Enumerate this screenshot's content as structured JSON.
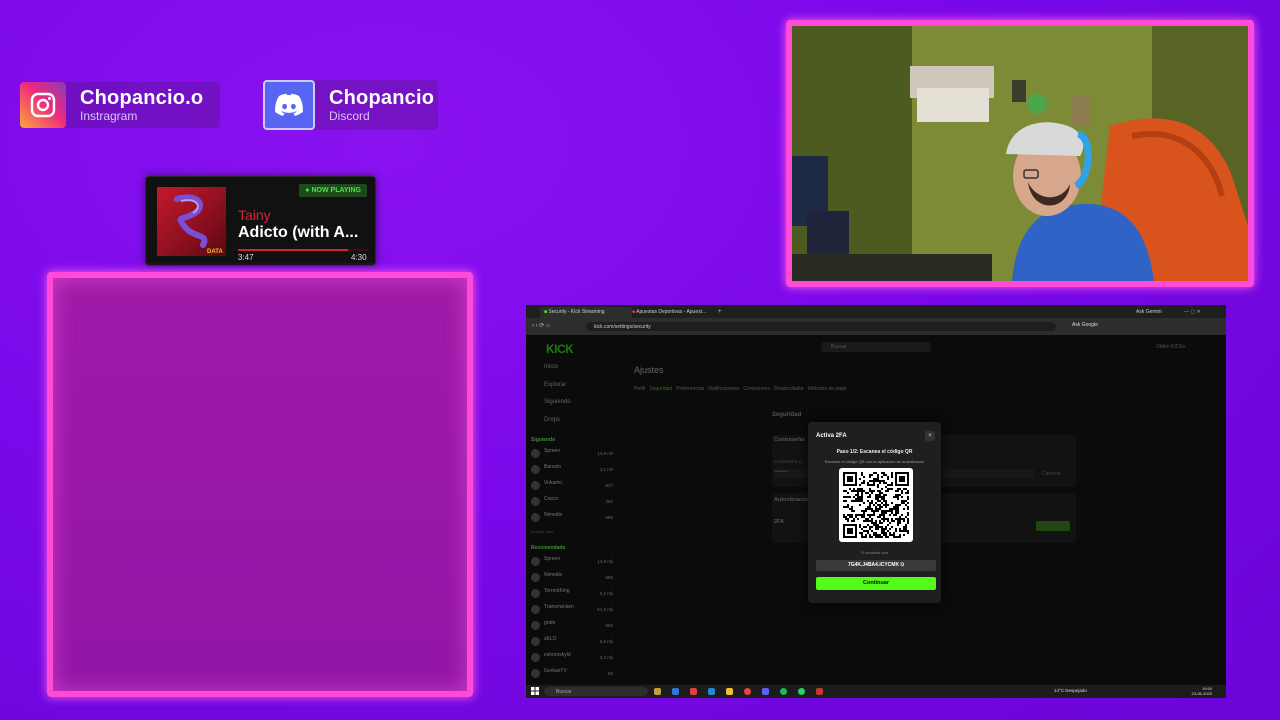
{
  "socials": [
    {
      "handle": "Chopancio.o",
      "platform": "Instragram",
      "icon": "instagram-icon"
    },
    {
      "handle": "Chopancio",
      "platform": "Discord",
      "icon": "discord-icon"
    }
  ],
  "now_playing": {
    "badge": "● NOW PLAYING",
    "artist": "Tainy",
    "song": "Adicto (with A...",
    "elapsed": "3:47",
    "duration": "4:30",
    "progress": 0.84,
    "cover_text": "DATA"
  },
  "browser": {
    "tabs": [
      "Security - Kick Streaming",
      "Apuestas Deportivas - Apuest..."
    ],
    "new_tab": "+",
    "url": "kick.com/settings/security",
    "ask_google": "Ask Google",
    "ask_gemini": "Ask Gemini",
    "logo": "KICK",
    "search_placeholder": "Buscar",
    "header_right": "Obtén KICKs",
    "nav": [
      "Inicio",
      "Explorar",
      "Siguiendo",
      "Drops"
    ],
    "following_title": "Siguiendo",
    "following": [
      {
        "name": "Spreen",
        "viewers": "14,8 mil"
      },
      {
        "name": "Barcelo",
        "viewers": "3,1 mil"
      },
      {
        "name": "Vokamo",
        "viewers": "827"
      },
      {
        "name": "Cosco",
        "viewers": "384"
      },
      {
        "name": "Nimedio",
        "viewers": "685"
      }
    ],
    "show_more": "Mostrar más",
    "recommended_title": "Recomendado",
    "recommended": [
      {
        "name": "Spreen",
        "viewers": "14,8 mil"
      },
      {
        "name": "Nimedio",
        "viewers": "685"
      },
      {
        "name": "TorrentKing",
        "viewers": "5,2 mil"
      },
      {
        "name": "Trainerwcken",
        "viewers": "51,9 mil"
      },
      {
        "name": "grafo",
        "viewers": "592"
      },
      {
        "name": "zELO",
        "viewers": "5,6 mil"
      },
      {
        "name": "eshoroskyld",
        "viewers": "3,3 mil"
      },
      {
        "name": "GorkaoTV",
        "viewers": "82"
      }
    ],
    "page_title": "Ajustes",
    "subtabs": [
      "Perfil",
      "Seguridad",
      "Preferencias",
      "Notificaciones",
      "Conexiones",
      "Desarrollador",
      "Métodos de pago"
    ],
    "active_subtab": "Seguridad",
    "section_security": "Seguridad",
    "section_password": "Contraseña",
    "password_label": "Contraseña a...",
    "password_value": "••••••••",
    "change_button": "Cambiar",
    "section_auth": "Autenticación",
    "twofa_label": "2FA",
    "activate_button": "Activar 2FA",
    "modal": {
      "title": "Activa 2FA",
      "close": "×",
      "step": "Paso 1/2: Escanea el código QR",
      "instruction": "Escanea el código QR con tu aplicación de autenticador",
      "or": "O continúa con",
      "code": "7G4K.J4BA4.ICYCMK",
      "continue": "Continuar"
    },
    "taskbar": {
      "search": "Buscar",
      "weather": "14°C  Despejado",
      "time": "19:50",
      "date": "23-06-2025"
    }
  },
  "colors": {
    "background": "#7a08ea",
    "neon": "#ff4bd8",
    "kick_green": "#53fc18",
    "spotify_red": "#d42436"
  }
}
